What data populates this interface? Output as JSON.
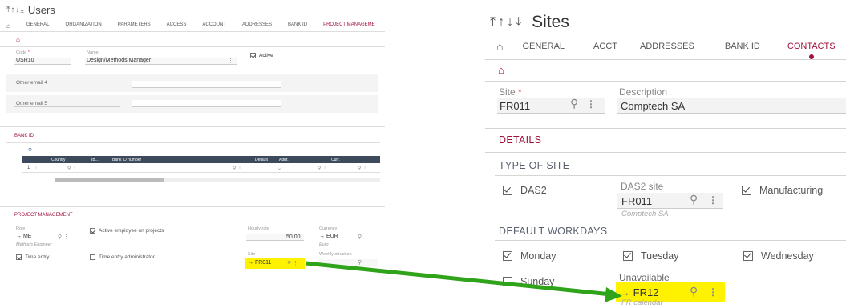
{
  "left": {
    "title": "Users",
    "tabs": [
      "GENERAL",
      "ORGANIZATION",
      "PARAMETERS",
      "ACCESS",
      "ACCOUNT",
      "ADDRESSES",
      "BANK ID",
      "PROJECT MANAGEME"
    ],
    "code_label": "Code",
    "code_value": "USR10",
    "name_label": "Name",
    "name_value": "Design/Methods Manager",
    "active_label": "Active",
    "other_email4": "Other email 4",
    "other_email5": "Other email 5",
    "bank_section": "BANK ID",
    "grid_columns": [
      "Country",
      "IB...",
      "Bank ID number",
      "Default",
      "Addr.",
      "Curr."
    ],
    "grid_row_num": "1",
    "pm_section": "PROJECT MANAGEMENT",
    "role_label": "Role",
    "role_value": "ME",
    "role_sub": "Methods Engineer",
    "active_emp_label": "Active employee on projects",
    "hourly_label": "Hourly rate",
    "hourly_value": "50.00",
    "currency_label": "Currency",
    "currency_value": "EUR",
    "currency_sub": "Euro",
    "time_entry_label": "Time entry",
    "time_entry_admin_label": "Time entry administrator",
    "site_label": "Site",
    "site_value": "FR011",
    "weekly_label": "Weekly structure"
  },
  "right": {
    "title": "Sites",
    "tabs": [
      "GENERAL",
      "ACCT",
      "ADDRESSES",
      "BANK ID",
      "CONTACTS"
    ],
    "site_label": "Site",
    "site_value": "FR011",
    "desc_label": "Description",
    "desc_value": "Comptech SA",
    "details_section": "DETAILS",
    "type_section": "TYPE OF SITE",
    "das2_label": "DAS2",
    "das2_site_label": "DAS2 site",
    "das2_site_value": "FR011",
    "das2_site_sub": "Comptech SA",
    "manufacturing_label": "Manufacturing",
    "workdays_section": "DEFAULT WORKDAYS",
    "monday": "Monday",
    "tuesday": "Tuesday",
    "wednesday": "Wednesday",
    "sunday": "Sunday",
    "unavailable_label": "Unavailable",
    "unavailable_value": "FR12",
    "unavailable_sub": "FR calendar"
  },
  "colors": {
    "accent": "#a0123c",
    "highlight": "#fff200",
    "arrow": "#2fa31a",
    "grid_header": "#3d4a5c"
  },
  "icons": {
    "home": "home-icon",
    "search": "search-icon",
    "more": "more-vert-icon",
    "jump": "jump-arrow-icon",
    "check": "checkbox-icon"
  }
}
